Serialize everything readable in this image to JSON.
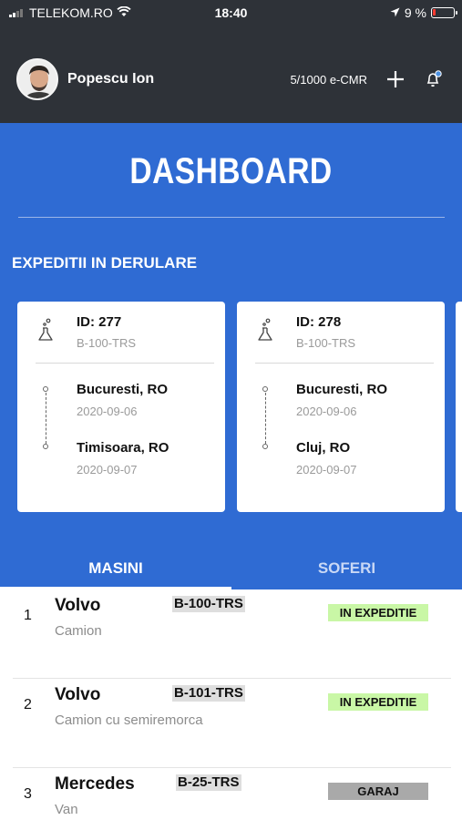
{
  "status_bar": {
    "carrier": "TELEKOM.RO",
    "time": "18:40",
    "battery": "9 %",
    "battery_level": 0.09
  },
  "header": {
    "user_name": "Popescu Ion",
    "quota": "5/1000 e-CMR",
    "icons": [
      "avatar",
      "plus-icon",
      "bell-icon"
    ]
  },
  "dashboard": {
    "title": "DASHBOARD",
    "section_label": "EXPEDITII IN DERULARE"
  },
  "shipments": [
    {
      "id": "ID: 277",
      "plate": "B-100-TRS",
      "from_city": "Bucuresti, RO",
      "from_date": "2020-09-06",
      "to_city": "Timisoara, RO",
      "to_date": "2020-09-07"
    },
    {
      "id": "ID: 278",
      "plate": "B-100-TRS",
      "from_city": "Bucuresti, RO",
      "from_date": "2020-09-06",
      "to_city": "Cluj, RO",
      "to_date": "2020-09-07"
    }
  ],
  "tabs": [
    {
      "label": "MASINI",
      "active": true
    },
    {
      "label": "SOFERI",
      "active": false
    }
  ],
  "vehicles": [
    {
      "index": "1",
      "make": "Volvo",
      "type": "Camion",
      "plate": "B-100-TRS",
      "status": "IN EXPEDITIE",
      "status_color": "#c9f7a6"
    },
    {
      "index": "2",
      "make": "Volvo",
      "type": "Camion cu semiremorca",
      "plate": "B-101-TRS",
      "status": "IN EXPEDITIE",
      "status_color": "#c9f7a6"
    },
    {
      "index": "3",
      "make": "Mercedes",
      "type": "Van",
      "plate": "B-25-TRS",
      "status": "GARAJ",
      "status_color": "#a9a9a9"
    }
  ],
  "colors": {
    "header_bg": "#2e3238",
    "accent_blue": "#2f6bd3"
  }
}
